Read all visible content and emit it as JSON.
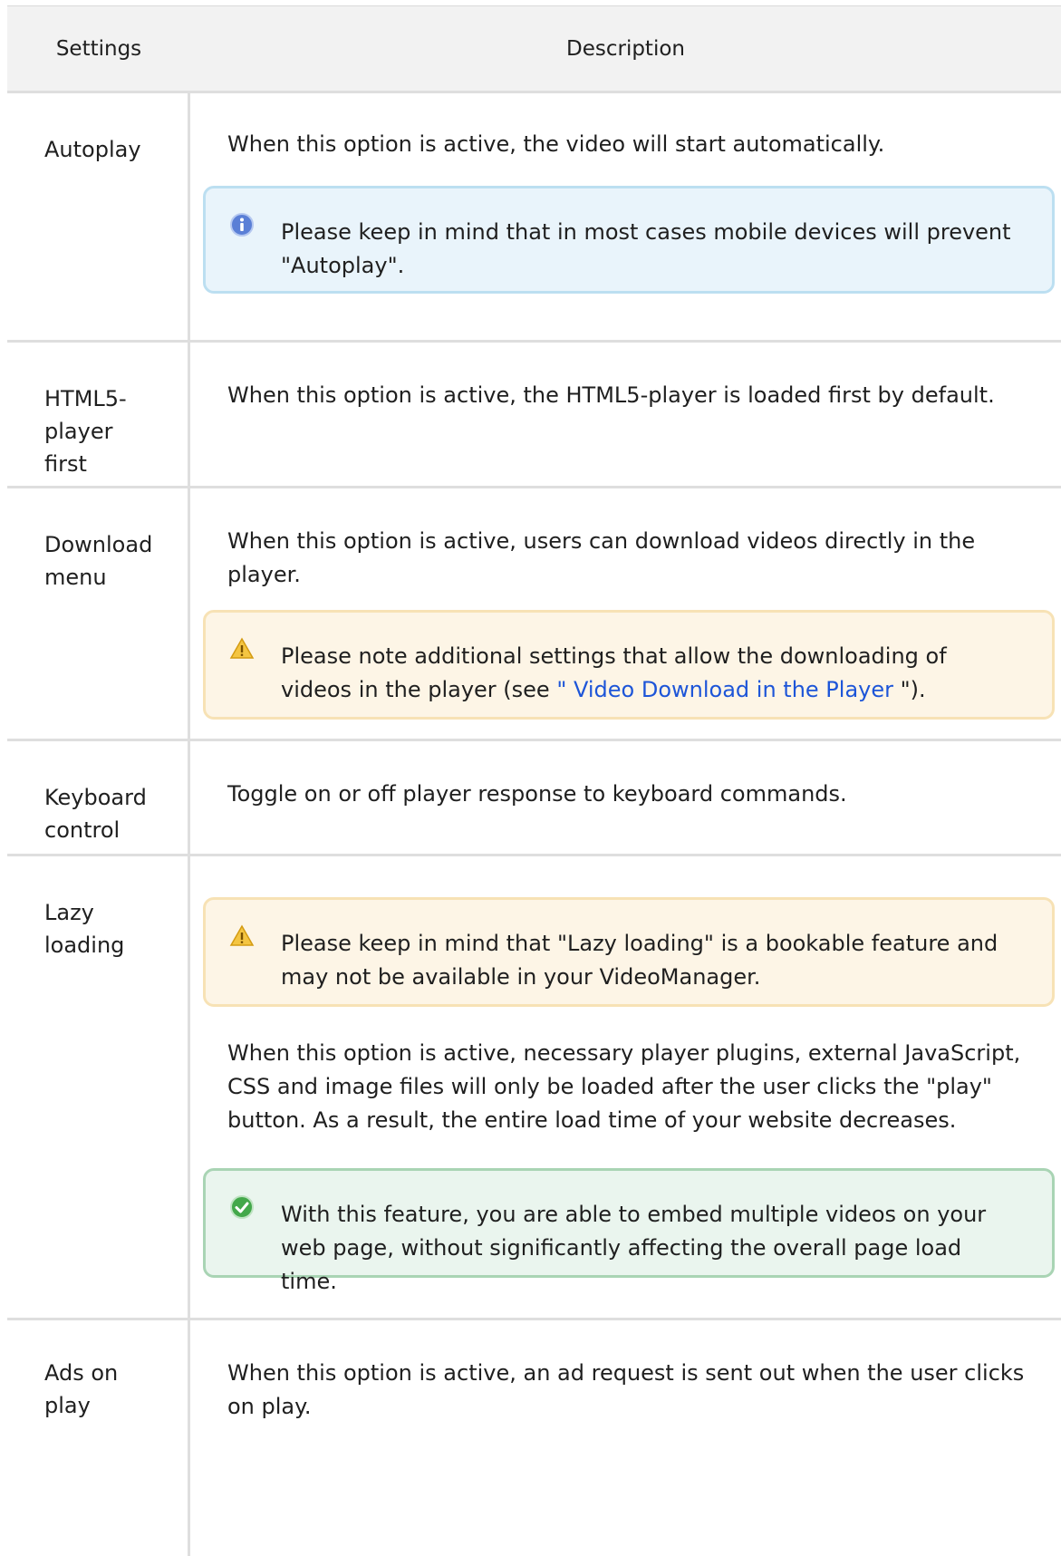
{
  "header": {
    "settings": "Settings",
    "description": "Description"
  },
  "rows": [
    {
      "setting": "Autoplay",
      "description": "When this option is active, the video will start automatically.",
      "note": "Please keep in mind that in most cases mobile devices will prevent \"Autoplay\"."
    },
    {
      "setting_lines": [
        "HTML5-",
        "player",
        "first"
      ],
      "description": "When this option is active, the HTML5-player is loaded first by default."
    },
    {
      "setting_lines": [
        "Download",
        "menu"
      ],
      "description": "When this option is active, users can download videos directly in the player.",
      "note_prefix": "Please note additional settings that allow the downloading of videos in the player (see ",
      "note_link": "\" Video Download in the Player",
      "note_suffix": " \")."
    },
    {
      "setting_lines": [
        "Keyboard",
        "control"
      ],
      "description": "Toggle on or off player response to keyboard commands."
    },
    {
      "setting_lines": [
        "Lazy",
        "loading"
      ],
      "warning": "Please keep in mind that \"Lazy loading\" is a bookable feature and may not be available in your VideoManager.",
      "description": "When this option is active, necessary player plugins, external JavaScript, CSS and image files will only be loaded after the user clicks the \"play\" button. As a result, the entire load time of your website decreases.",
      "tip": "With this feature, you are able to embed multiple videos on your web page, without significantly affecting the overall page load time."
    },
    {
      "setting_lines": [
        "Ads on",
        "play"
      ],
      "description": "When this option is active, an ad request is sent out when the user clicks on play."
    }
  ],
  "icons": {
    "info": "info-icon",
    "warning": "warning-icon",
    "success": "check-icon"
  },
  "colors": {
    "info_bg": "#e9f4fb",
    "warning_bg": "#fdf5e6",
    "success_bg": "#eaf5ee",
    "link": "#1d55d8"
  }
}
